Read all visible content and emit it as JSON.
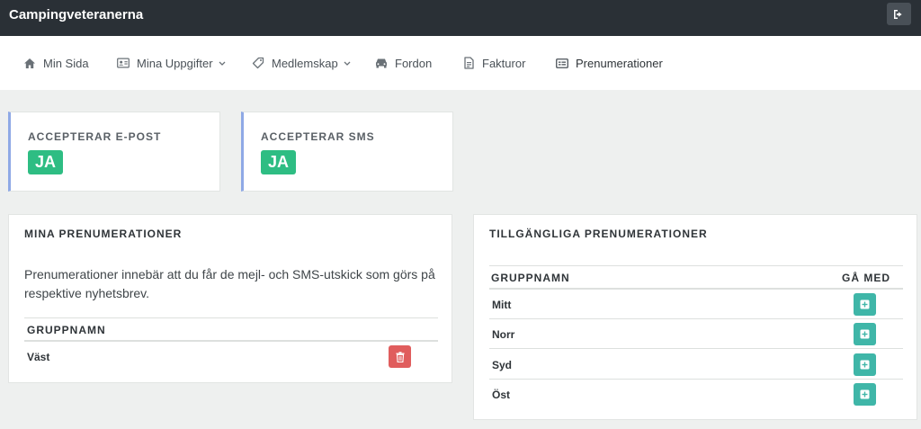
{
  "app": {
    "title": "Campingveteranerna"
  },
  "nav": {
    "items": [
      {
        "label": "Min Sida",
        "icon": "home-icon"
      },
      {
        "label": "Mina Uppgifter",
        "icon": "id-card-icon",
        "dropdown": true
      },
      {
        "label": "Medlemskap",
        "icon": "tag-icon",
        "dropdown": true
      },
      {
        "label": "Fordon",
        "icon": "car-icon"
      },
      {
        "label": "Fakturor",
        "icon": "invoice-icon"
      },
      {
        "label": "Prenumerationer",
        "icon": "subscription-icon"
      }
    ]
  },
  "stats": {
    "email": {
      "label": "ACCEPTERAR E-POST",
      "value": "JA"
    },
    "sms": {
      "label": "ACCEPTERAR SMS",
      "value": "JA"
    }
  },
  "my_subscriptions": {
    "title": "MINA PRENUMERATIONER",
    "description": "Prenumerationer innebär att du får de mejl- och SMS-utskick som görs på respektive nyhetsbrev.",
    "column": "GRUPPNAMN",
    "rows": [
      {
        "name": "Väst"
      }
    ]
  },
  "available_subscriptions": {
    "title": "TILLGÄNGLIGA PRENUMERATIONER",
    "col_name": "GRUPPNAMN",
    "col_join": "GÅ MED",
    "rows": [
      {
        "name": "Mitt"
      },
      {
        "name": "Norr"
      },
      {
        "name": "Syd"
      },
      {
        "name": "Öst"
      }
    ]
  },
  "colors": {
    "topbar": "#2a3036",
    "badge": "#2ebd83",
    "accent": "#8fa9e6",
    "delete": "#e05d5d",
    "add": "#3fb6a8"
  }
}
